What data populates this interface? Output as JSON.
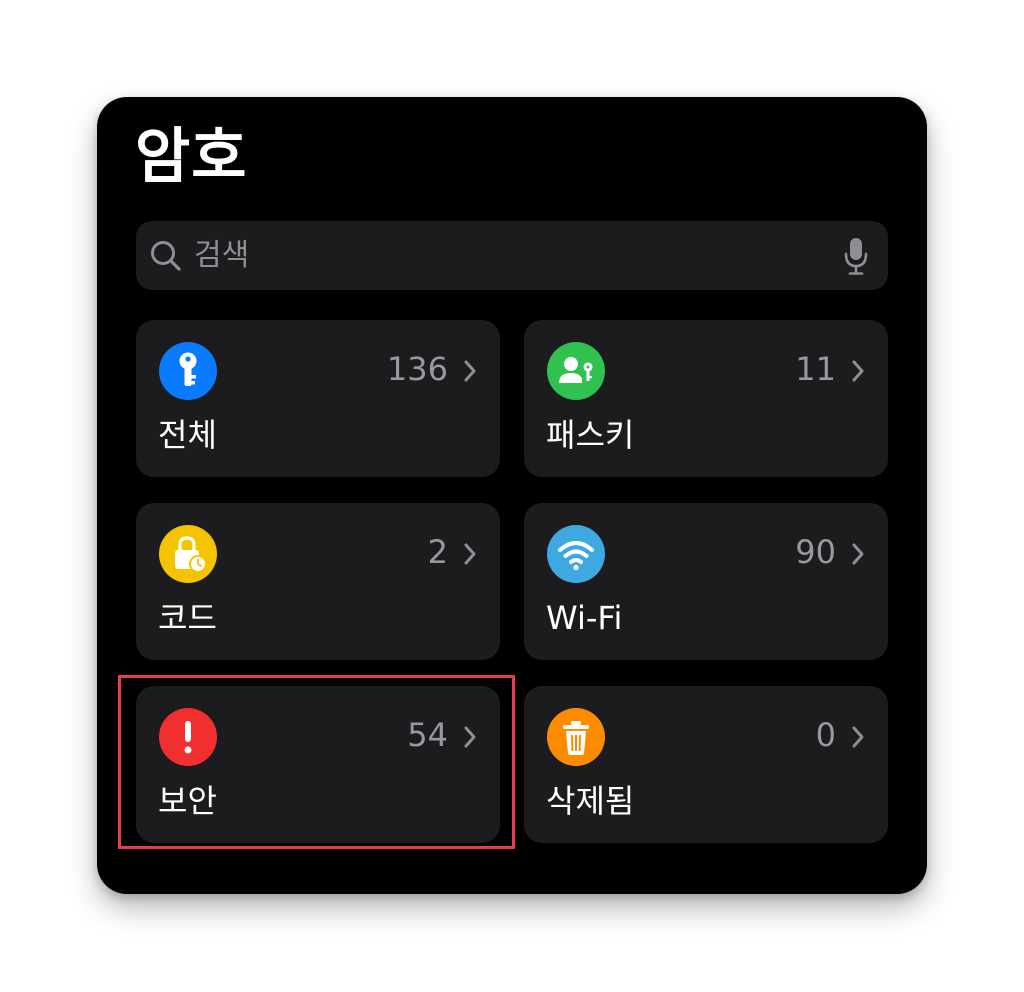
{
  "header": {
    "title": "암호"
  },
  "search": {
    "placeholder": "검색",
    "icon": "search-icon",
    "mic_icon": "microphone-icon"
  },
  "tiles": [
    {
      "id": "all",
      "label": "전체",
      "count": "136",
      "icon": "key-icon",
      "color": "#0a7aff"
    },
    {
      "id": "passkeys",
      "label": "패스키",
      "count": "11",
      "icon": "person-key-icon",
      "color": "#30c24f"
    },
    {
      "id": "codes",
      "label": "코드",
      "count": "2",
      "icon": "lock-clock-icon",
      "color": "#f5c400"
    },
    {
      "id": "wifi",
      "label": "Wi-Fi",
      "count": "90",
      "icon": "wifi-icon",
      "color": "#3ea9e0"
    },
    {
      "id": "security",
      "label": "보안",
      "count": "54",
      "icon": "exclamation-icon",
      "color": "#f12f2f"
    },
    {
      "id": "deleted",
      "label": "삭제됨",
      "count": "0",
      "icon": "trash-icon",
      "color": "#ff8c00"
    }
  ],
  "colors": {
    "background": "#000000",
    "tile": "#1c1c1e",
    "highlight": "#e63f4b"
  }
}
